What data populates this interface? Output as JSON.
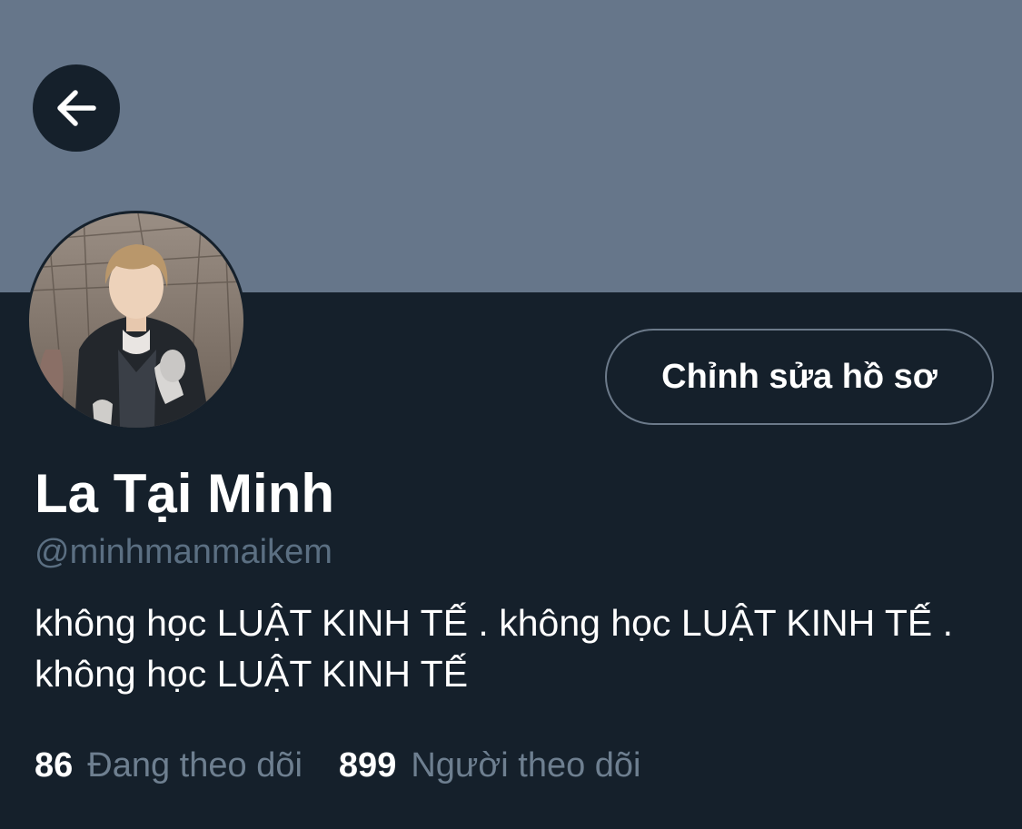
{
  "header": {
    "back_icon": "arrow-left-icon",
    "banner_color": "#66768a"
  },
  "profile": {
    "display_name": "La Tại Minh",
    "handle": "@minhmanmaikem",
    "bio": "không học LUẬT KINH TẾ . không học LUẬT KINH TẾ . không học LUẬT KINH TẾ",
    "edit_button_label": "Chỉnh sửa hồ sơ"
  },
  "stats": {
    "following_count": "86",
    "following_label": "Đang theo dõi",
    "followers_count": "899",
    "followers_label": "Người theo dõi"
  },
  "colors": {
    "background": "#15202b",
    "secondary_text": "#6e7f90",
    "button_border": "#6c7a8a"
  }
}
